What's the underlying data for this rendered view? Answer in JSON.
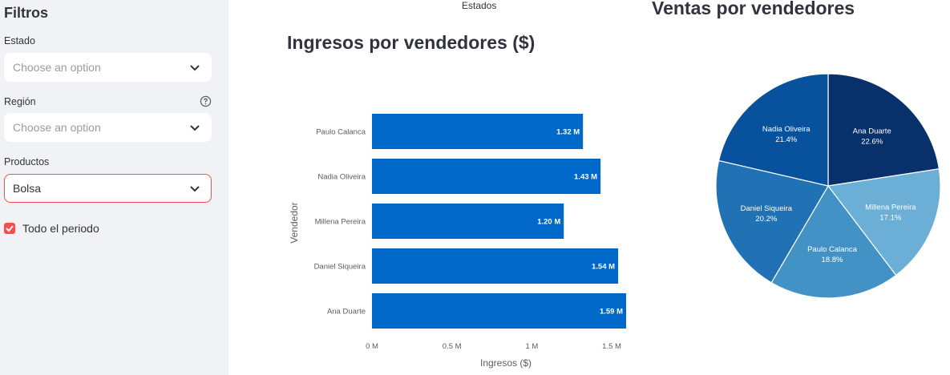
{
  "sidebar": {
    "title": "Filtros",
    "estado": {
      "label": "Estado",
      "placeholder": "Choose an option"
    },
    "region": {
      "label": "Región",
      "placeholder": "Choose an option"
    },
    "productos": {
      "label": "Productos",
      "value": "Bolsa"
    },
    "todo_periodo": {
      "label": "Todo el periodo",
      "checked": true
    }
  },
  "header": {
    "estados_label": "Estados"
  },
  "bar_title": "Ingresos por vendedores ($)",
  "pie_title": "Ventas por vendedores",
  "chart_data": [
    {
      "type": "bar",
      "orientation": "horizontal",
      "title": "Ingresos por vendedores ($)",
      "xlabel": "Ingresos ($)",
      "ylabel": "Vendedor",
      "categories": [
        "Paulo Calanca",
        "Nadia Oliveira",
        "Millena Pereira",
        "Daniel Siqueira",
        "Ana Duarte"
      ],
      "values": [
        1320000,
        1430000,
        1200000,
        1540000,
        1590000
      ],
      "data_labels": [
        "1.32 M",
        "1.43 M",
        "1.20 M",
        "1.54 M",
        "1.59 M"
      ],
      "x_ticks": [
        0,
        500000,
        1000000,
        1500000
      ],
      "x_tick_labels": [
        "0 M",
        "0.5 M",
        "1 M",
        "1.5 M"
      ],
      "xlim": [
        0,
        1590000
      ],
      "color": "#0068c9"
    },
    {
      "type": "pie",
      "title": "Ventas por vendedores",
      "slices": [
        {
          "label": "Ana Duarte",
          "value": 22.6,
          "pct_label": "22.6%",
          "color": "#08306b"
        },
        {
          "label": "Millena Pereira",
          "value": 17.1,
          "pct_label": "17.1%",
          "color": "#6baed6"
        },
        {
          "label": "Paulo Calanca",
          "value": 18.8,
          "pct_label": "18.8%",
          "color": "#4292c6"
        },
        {
          "label": "Daniel Siqueira",
          "value": 20.2,
          "pct_label": "20.2%",
          "color": "#2171b5"
        },
        {
          "label": "Nadia Oliveira",
          "value": 21.4,
          "pct_label": "21.4%",
          "color": "#08519c"
        }
      ]
    }
  ]
}
